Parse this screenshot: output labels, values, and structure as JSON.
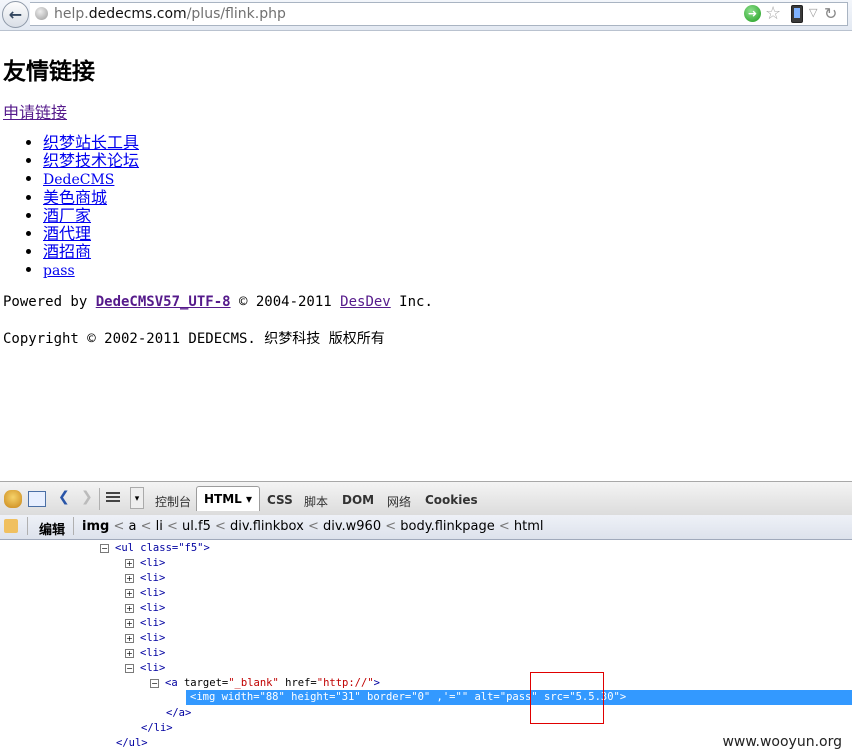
{
  "browser": {
    "url_prefix": "help.",
    "url_domain": "dedecms.com",
    "url_path": "/plus/flink.php"
  },
  "page": {
    "title": "友情链接",
    "apply_link": "申请链接",
    "links": [
      "织梦站长工具",
      "织梦技术论坛",
      "DedeCMS",
      "美色商城",
      "酒厂家",
      "酒代理",
      "酒招商",
      "pass"
    ],
    "powered_prefix": "Powered by ",
    "powered_link": "DedeCMSV57_UTF-8",
    "powered_middle": " © 2004-2011 ",
    "powered_link2": "DesDev",
    "powered_suffix": " Inc.",
    "copyright": "Copyright © 2002-2011 DEDECMS. 织梦科技 版权所有"
  },
  "firebug": {
    "tabs": [
      "控制台",
      "HTML",
      "CSS",
      "脚本",
      "DOM",
      "网络",
      "Cookies"
    ],
    "edit_label": "编辑",
    "breadcrumb": [
      "img",
      "a",
      "li",
      "ul.f5",
      "div.flinkbox",
      "div.w960",
      "body.flinkpage",
      "html"
    ],
    "tree": {
      "ul_open": "<ul class=\"f5\">",
      "li_collapsed": "<li>",
      "li_open": "<li>",
      "a_open_tag": "<a ",
      "a_attr1_name": "target=",
      "a_attr1_val": "\"_blank\"",
      "a_attr2_name": " href=",
      "a_attr2_val": "\"http://\"",
      "a_close_bracket": ">",
      "img_line": "<img width=\"88\" height=\"31\" border=\"0\" ,'=\"\" alt=\"pass\" src=\"5.5.30\">",
      "a_close": "</a>",
      "li_close": "</li>",
      "ul_close": "</ul>"
    }
  },
  "watermark": "www.wooyun.org"
}
